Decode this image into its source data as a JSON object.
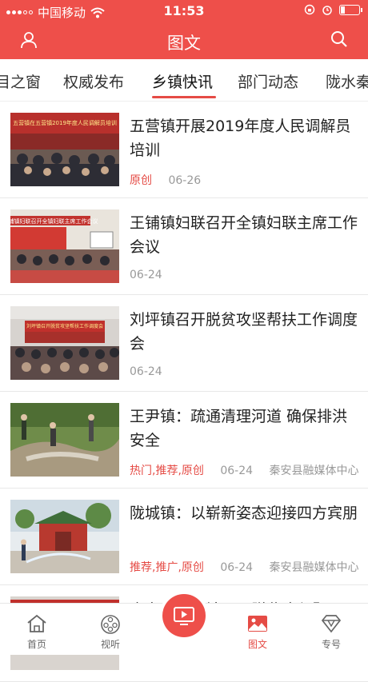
{
  "status_bar": {
    "carrier": "中国移动",
    "time": "11:53"
  },
  "header": {
    "title": "图文"
  },
  "tabs": [
    {
      "label": "目之窗"
    },
    {
      "label": "权威发布"
    },
    {
      "label": "乡镇快讯"
    },
    {
      "label": "部门动态"
    },
    {
      "label": "陇水秦"
    }
  ],
  "articles": [
    {
      "title": "五营镇开展2019年度人民调解员培训",
      "tags": "原创",
      "date": "06-26",
      "source": "",
      "image_banner": "五营镇在五营镇2019年度人民调解员培训"
    },
    {
      "title": "王铺镇妇联召开全镇妇联主席工作会议",
      "tags": "",
      "date": "06-24",
      "source": "",
      "image_banner": "王铺镇妇联召开全镇妇联主席工作会议"
    },
    {
      "title": "刘坪镇召开脱贫攻坚帮扶工作调度会",
      "tags": "",
      "date": "06-24",
      "source": "",
      "image_banner": "刘坪镇召开脱贫攻坚帮扶工作调度会"
    },
    {
      "title": "王尹镇：疏通清理河道 确保排洪安全",
      "tags": "热门,推荐,原创",
      "date": "06-24",
      "source": "秦安县融媒体中心",
      "image_banner": ""
    },
    {
      "title": "陇城镇：以崭新姿态迎接四方宾朋",
      "tags": "推荐,推广,原创",
      "date": "06-24",
      "source": "秦安县融媒体中心",
      "image_banner": ""
    },
    {
      "title": "秦安县兴丰镇召开脱贫攻坚暨",
      "tags": "",
      "date": "",
      "source": "",
      "image_banner": ""
    }
  ],
  "bottom_nav": [
    {
      "label": "首页",
      "icon": "home-icon"
    },
    {
      "label": "视听",
      "icon": "film-reel-icon"
    },
    {
      "label": "",
      "icon": "video-play-icon"
    },
    {
      "label": "图文",
      "icon": "image-icon"
    },
    {
      "label": "专号",
      "icon": "diamond-icon"
    }
  ],
  "colors": {
    "brand_red": "#ee4f4a",
    "tag_red": "#e54b45",
    "meta_gray": "#999999"
  }
}
